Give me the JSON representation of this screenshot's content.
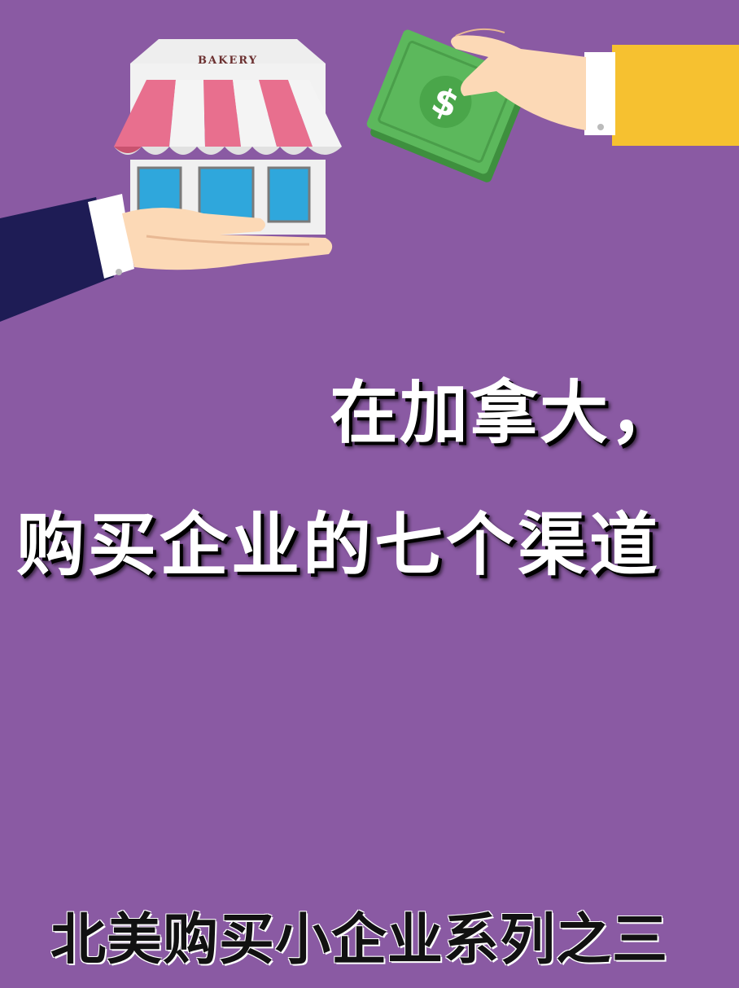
{
  "illustration": {
    "shop_sign": "BAKERY",
    "money_symbol": "$",
    "colors": {
      "background": "#8a5aa3",
      "awning_pink": "#e86f8e",
      "awning_white": "#f2f2f2",
      "window_blue": "#2fa7dc",
      "buyer_sleeve": "#1e1c55",
      "seller_sleeve": "#f6c130",
      "money_green": "#5cb85c",
      "skin": "#fcd9b6"
    }
  },
  "headline": {
    "line1": "在加拿大，",
    "line2": "购买企业的七个渠道"
  },
  "series_label": "北美购买小企业系列之三"
}
